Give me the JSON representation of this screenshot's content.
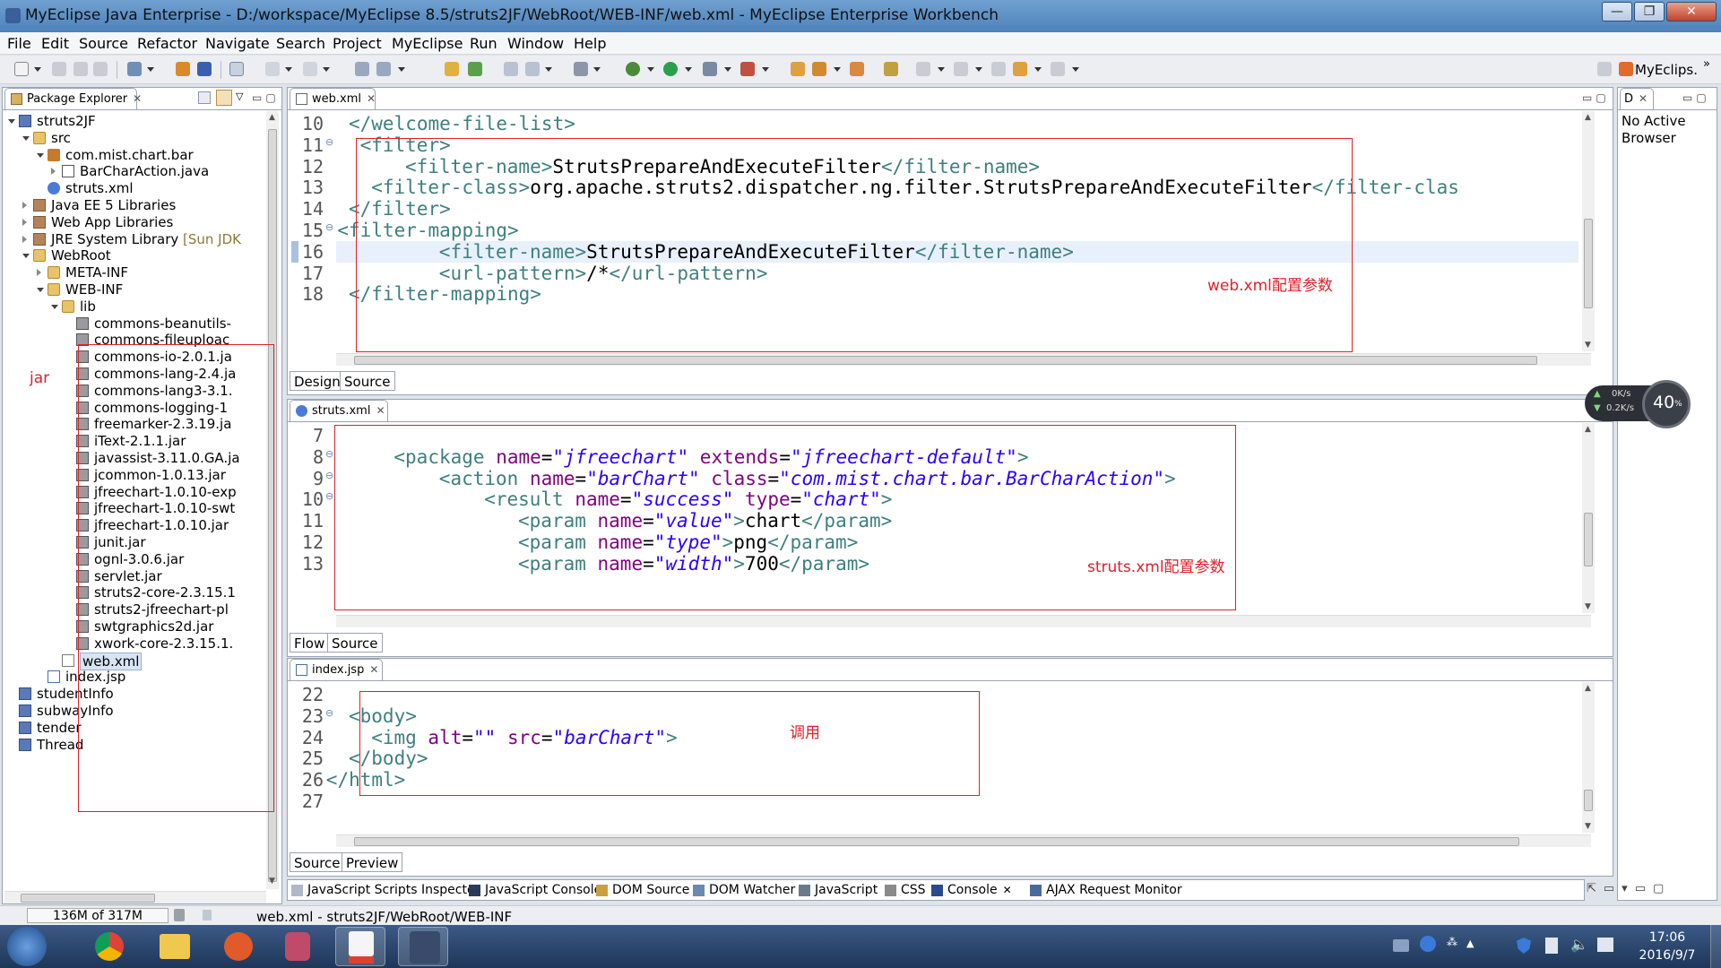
{
  "window": {
    "title": "MyEclipse Java Enterprise - D:/workspace/MyEclipse 8.5/struts2JF/WebRoot/WEB-INF/web.xml - MyEclipse Enterprise Workbench",
    "controls": [
      "—",
      "❐",
      "✕"
    ]
  },
  "menu": [
    "File",
    "Edit",
    "Source",
    "Refactor",
    "Navigate",
    "Search",
    "Project",
    "MyEclipse",
    "Run",
    "Window",
    "Help"
  ],
  "perspective": {
    "label": "MyEclips."
  },
  "package_explorer": {
    "title": "Package Explorer",
    "items": [
      {
        "label": "struts2JF",
        "icon": "project-icon",
        "depth": 0,
        "toggle": "open"
      },
      {
        "label": "src",
        "icon": "folder-icon",
        "depth": 1,
        "toggle": "open"
      },
      {
        "label": "com.mist.chart.bar",
        "icon": "package-icon",
        "depth": 2,
        "toggle": "open"
      },
      {
        "label": "BarCharAction.java",
        "icon": "java-file-icon",
        "depth": 3,
        "toggle": "closed"
      },
      {
        "label": "struts.xml",
        "icon": "config-gear-icon",
        "depth": 2,
        "toggle": ""
      },
      {
        "label": "Java EE 5 Libraries",
        "icon": "library-icon",
        "depth": 1,
        "toggle": "closed"
      },
      {
        "label": "Web App Libraries",
        "icon": "library-icon",
        "depth": 1,
        "toggle": "closed"
      },
      {
        "label": "JRE System Library",
        "suffix": "[Sun JDK",
        "icon": "library-icon",
        "depth": 1,
        "toggle": "closed"
      },
      {
        "label": "WebRoot",
        "icon": "folder-icon",
        "depth": 1,
        "toggle": "open"
      },
      {
        "label": "META-INF",
        "icon": "folder-icon",
        "depth": 2,
        "toggle": "closed"
      },
      {
        "label": "WEB-INF",
        "icon": "folder-icon",
        "depth": 2,
        "toggle": "open"
      },
      {
        "label": "lib",
        "icon": "folder-icon",
        "depth": 3,
        "toggle": "open"
      },
      {
        "label": "commons-beanutils-",
        "icon": "jar-icon",
        "depth": 4,
        "toggle": ""
      },
      {
        "label": "commons-fileuploac",
        "icon": "jar-icon",
        "depth": 4,
        "toggle": ""
      },
      {
        "label": "commons-io-2.0.1.ja",
        "icon": "jar-icon",
        "depth": 4,
        "toggle": ""
      },
      {
        "label": "commons-lang-2.4.ja",
        "icon": "jar-icon",
        "depth": 4,
        "toggle": ""
      },
      {
        "label": "commons-lang3-3.1.",
        "icon": "jar-icon",
        "depth": 4,
        "toggle": ""
      },
      {
        "label": "commons-logging-1",
        "icon": "jar-icon",
        "depth": 4,
        "toggle": ""
      },
      {
        "label": "freemarker-2.3.19.ja",
        "icon": "jar-icon",
        "depth": 4,
        "toggle": ""
      },
      {
        "label": "iText-2.1.1.jar",
        "icon": "jar-icon",
        "depth": 4,
        "toggle": ""
      },
      {
        "label": "javassist-3.11.0.GA.ja",
        "icon": "jar-icon",
        "depth": 4,
        "toggle": ""
      },
      {
        "label": "jcommon-1.0.13.jar",
        "icon": "jar-icon",
        "depth": 4,
        "toggle": ""
      },
      {
        "label": "jfreechart-1.0.10-exp",
        "icon": "jar-icon",
        "depth": 4,
        "toggle": ""
      },
      {
        "label": "jfreechart-1.0.10-swt",
        "icon": "jar-icon",
        "depth": 4,
        "toggle": ""
      },
      {
        "label": "jfreechart-1.0.10.jar",
        "icon": "jar-icon",
        "depth": 4,
        "toggle": ""
      },
      {
        "label": "junit.jar",
        "icon": "jar-icon",
        "depth": 4,
        "toggle": ""
      },
      {
        "label": "ognl-3.0.6.jar",
        "icon": "jar-icon",
        "depth": 4,
        "toggle": ""
      },
      {
        "label": "servlet.jar",
        "icon": "jar-icon",
        "depth": 4,
        "toggle": ""
      },
      {
        "label": "struts2-core-2.3.15.1",
        "icon": "jar-icon",
        "depth": 4,
        "toggle": ""
      },
      {
        "label": "struts2-jfreechart-pl",
        "icon": "jar-icon",
        "depth": 4,
        "toggle": ""
      },
      {
        "label": "swtgraphics2d.jar",
        "icon": "jar-icon",
        "depth": 4,
        "toggle": ""
      },
      {
        "label": "xwork-core-2.3.15.1.",
        "icon": "jar-icon",
        "depth": 4,
        "toggle": ""
      },
      {
        "label": "web.xml",
        "icon": "xml-file-icon",
        "depth": 3,
        "toggle": "",
        "selected": true
      },
      {
        "label": "index.jsp",
        "icon": "jsp-file-icon",
        "depth": 2,
        "toggle": ""
      },
      {
        "label": "studentInfo",
        "icon": "project-icon",
        "depth": 0,
        "toggle": ""
      },
      {
        "label": "subwayInfo",
        "icon": "project-icon",
        "depth": 0,
        "toggle": ""
      },
      {
        "label": "tender",
        "icon": "project-icon",
        "depth": 0,
        "toggle": ""
      },
      {
        "label": "Thread",
        "icon": "project-icon",
        "depth": 0,
        "toggle": ""
      }
    ],
    "annotation": "jar"
  },
  "browser_view": {
    "tab": "D",
    "text": "No Active Browser"
  },
  "editors": {
    "web": {
      "tab": "web.xml",
      "subtabs": [
        "Design",
        "Source"
      ],
      "annotation": "web.xml配置参数",
      "lines": [
        {
          "n": "10",
          "fold": "",
          "html": "<span class='tag'>&lt;/welcome-file-list&gt;</span>",
          "indent": 0
        },
        {
          "n": "11",
          "fold": "⊖",
          "html": "<span class='tag'>&lt;filter&gt;</span>",
          "indent": 1
        },
        {
          "n": "12",
          "fold": "",
          "html": "<span class='tag'>&lt;filter-name&gt;</span><span class='txt'>StrutsPrepareAndExecuteFilter</span><span class='tag'>&lt;/filter-name&gt;</span>",
          "indent": 5
        },
        {
          "n": "13",
          "fold": "",
          "html": "<span class='tag'>&lt;filter-class&gt;</span><span class='txt'>org.apache.struts2.dispatcher.ng.filter.StrutsPrepareAndExecuteFilter</span><span class='tag'>&lt;/filter-clas</span>",
          "indent": 2
        },
        {
          "n": "14",
          "fold": "",
          "html": "<span class='tag'>&lt;/filter&gt;</span>",
          "indent": 0
        },
        {
          "n": "15",
          "fold": "⊖",
          "html": "<span class='tag'>&lt;filter-mapping&gt;</span>",
          "indent": -1
        },
        {
          "n": "16",
          "fold": "",
          "html": "<span class='tag'>&lt;filter-name&gt;</span><span class='txt'>StrutsPrepareAndExecuteFilter</span><span class='tag'>&lt;/filter-name&gt;</span>",
          "indent": 8
        },
        {
          "n": "17",
          "fold": "",
          "html": "<span class='tag'>&lt;url-pattern&gt;</span><span class='txt'>/*</span><span class='tag'>&lt;/url-pattern&gt;</span>",
          "indent": 8
        },
        {
          "n": "18",
          "fold": "",
          "html": "<span class='tag'>&lt;/filter-mapping&gt;</span>",
          "indent": 0
        }
      ]
    },
    "struts": {
      "tab": "struts.xml",
      "subtabs": [
        "Flow",
        "Source"
      ],
      "annotation": "struts.xml配置参数",
      "lines": [
        {
          "n": "7",
          "fold": "",
          "html": "",
          "indent": 0
        },
        {
          "n": "8",
          "fold": "⊖",
          "html": "<span class='tag'>&lt;package </span><span class='attr'>name</span><span class='txt'>=</span><span class='str'>\"jfreechart\"</span> <span class='attr'>extends</span><span class='txt'>=</span><span class='str'>\"jfreechart-default\"</span><span class='tag'>&gt;</span>",
          "indent": 4
        },
        {
          "n": "9",
          "fold": "⊖",
          "html": "<span class='tag'>&lt;action </span><span class='attr'>name</span><span class='txt'>=</span><span class='str'>\"barChart\"</span> <span class='attr'>class</span><span class='txt'>=</span><span class='str'>\"com.mist.chart.bar.BarCharAction\"</span><span class='tag'>&gt;</span>",
          "indent": 8
        },
        {
          "n": "10",
          "fold": "⊖",
          "html": "<span class='tag'>&lt;result </span><span class='attr'>name</span><span class='txt'>=</span><span class='str'>\"success\"</span> <span class='attr'>type</span><span class='txt'>=</span><span class='str'>\"chart\"</span><span class='tag'>&gt;</span>",
          "indent": 12
        },
        {
          "n": "11",
          "fold": "",
          "html": "<span class='tag'>&lt;param </span><span class='attr'>name</span><span class='txt'>=</span><span class='str'>\"value\"</span><span class='tag'>&gt;</span><span class='txt'>chart</span><span class='tag'>&lt;/param&gt;</span>",
          "indent": 15
        },
        {
          "n": "12",
          "fold": "",
          "html": "<span class='tag'>&lt;param </span><span class='attr'>name</span><span class='txt'>=</span><span class='str'>\"type\"</span><span class='tag'>&gt;</span><span class='txt'>png</span><span class='tag'>&lt;/param&gt;</span>",
          "indent": 15
        },
        {
          "n": "13",
          "fold": "",
          "html": "<span class='tag'>&lt;param </span><span class='attr'>name</span><span class='txt'>=</span><span class='str'>\"width\"</span><span class='tag'>&gt;</span><span class='txt'>700</span><span class='tag'>&lt;/param&gt;</span>",
          "indent": 15
        }
      ]
    },
    "index": {
      "tab": "index.jsp",
      "subtabs": [
        "Source",
        "Preview"
      ],
      "annotation": "调用",
      "lines": [
        {
          "n": "22",
          "fold": "",
          "html": "",
          "indent": 0
        },
        {
          "n": "23",
          "fold": "⊖",
          "html": "<span class='tag'>&lt;body&gt;</span>",
          "indent": 0
        },
        {
          "n": "24",
          "fold": "",
          "html": "<span class='tag'>&lt;img </span><span class='attr'>alt</span><span class='txt'>=</span><span class='str'>\"\"</span> <span class='attr'>src</span><span class='txt'>=</span><span class='str'>\"barChart\"</span><span class='tag'>&gt;</span>",
          "indent": 2
        },
        {
          "n": "25",
          "fold": "",
          "html": "<span class='tag'>&lt;/body&gt;</span>",
          "indent": 0
        },
        {
          "n": "26",
          "fold": "",
          "html": "<span class='tag'>&lt;/html&gt;</span>",
          "indent": -2
        },
        {
          "n": "27",
          "fold": "",
          "html": "",
          "indent": 0
        }
      ]
    }
  },
  "bottom_tabs": [
    "JavaScript Scripts Inspector",
    "JavaScript Console",
    "DOM Source",
    "DOM Watcher",
    "JavaScript",
    "CSS",
    "Console",
    "AJAX Request Monitor"
  ],
  "status": {
    "heap": "136M of 317M",
    "path": "web.xml - struts2JF/WebRoot/WEB-INF"
  },
  "net_widget": {
    "up": "0K/s",
    "down": "0.2K/s",
    "percent": "40",
    "unit": "%"
  },
  "clock": {
    "time": "17:06",
    "date": "2016/9/7"
  },
  "colors": {
    "annotation_red": "#e0202a",
    "tag": "#3f7f7f",
    "attr": "#7f007f",
    "string": "#2a00ff"
  }
}
